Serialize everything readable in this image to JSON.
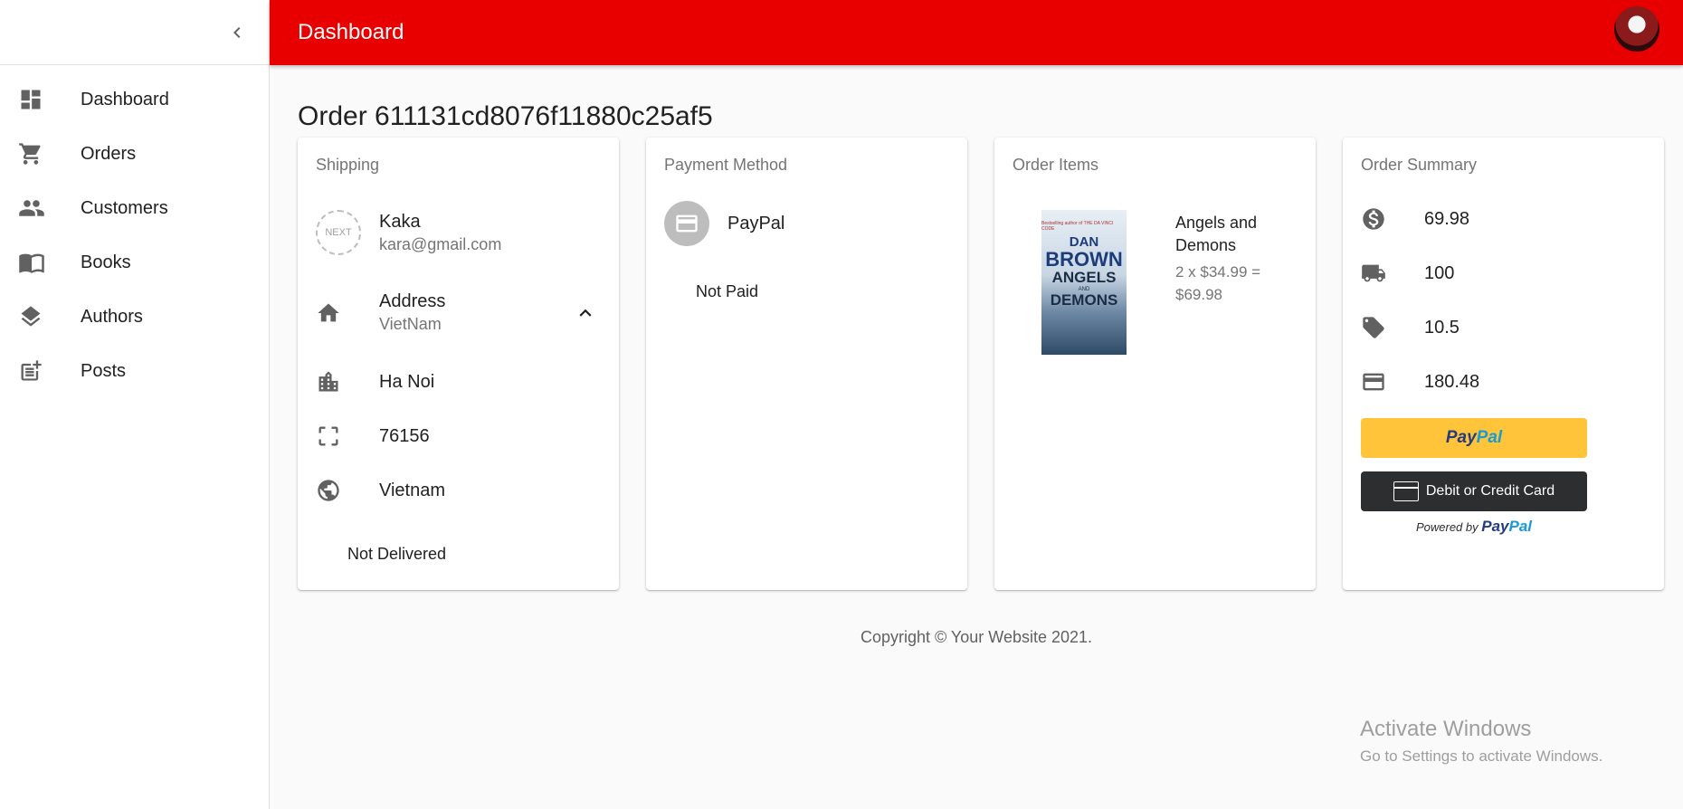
{
  "header": {
    "title": "Dashboard"
  },
  "sidebar": {
    "items": [
      {
        "label": "Dashboard",
        "icon": "dashboard-icon"
      },
      {
        "label": "Orders",
        "icon": "cart-icon"
      },
      {
        "label": "Customers",
        "icon": "people-icon"
      },
      {
        "label": "Books",
        "icon": "book-icon"
      },
      {
        "label": "Authors",
        "icon": "layers-icon"
      },
      {
        "label": "Posts",
        "icon": "post-add-icon"
      }
    ]
  },
  "order": {
    "title": "Order 611131cd8076f11880c25af5"
  },
  "shipping": {
    "title": "Shipping",
    "avatar_text": "NEXT",
    "name": "Kaka",
    "email": "kara@gmail.com",
    "address_label": "Address",
    "address_country": "VietNam",
    "city": "Ha Noi",
    "postal_code": "76156",
    "country": "Vietnam",
    "status": "Not Delivered"
  },
  "payment": {
    "title": "Payment Method",
    "method": "PayPal",
    "status": "Not Paid"
  },
  "items": {
    "title": "Order Items",
    "list": [
      {
        "name": "Angels and Demons",
        "price_line": "2 x $34.99 = $69.98",
        "cover": {
          "top_line": "Bestselling author of THE DA VINCI CODE",
          "author_first": "DAN",
          "author_last": "BROWN",
          "title_line1": "ANGELS",
          "title_and": "AND",
          "title_line2": "DEMONS"
        }
      }
    ]
  },
  "summary": {
    "title": "Order Summary",
    "items_price": "69.98",
    "shipping_price": "100",
    "tax_price": "10.5",
    "total_price": "180.48",
    "paypal_button": {
      "part1": "Pay",
      "part2": "Pal"
    },
    "card_button_label": "Debit or Credit Card",
    "powered_by": "Powered by",
    "powered_logo": {
      "part1": "Pay",
      "part2": "Pal"
    }
  },
  "footer": {
    "text": "Copyright © Your Website 2021."
  },
  "watermark": {
    "line1": "Activate Windows",
    "line2": "Go to Settings to activate Windows."
  },
  "colors": {
    "appbar": "#e80000",
    "icon": "#616161",
    "paypal_yellow": "#ffc439",
    "paypal_dark_blue": "#253b80",
    "paypal_light_blue": "#179bd7"
  }
}
